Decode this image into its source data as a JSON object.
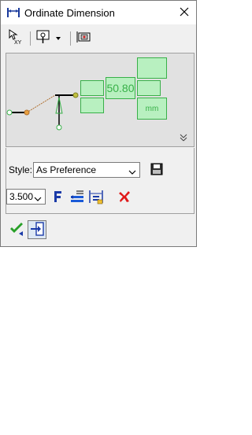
{
  "window": {
    "title": "Ordinate Dimension",
    "icon": "ordinate-dimension-icon",
    "close_icon": "close-icon"
  },
  "toolbar": {
    "items": [
      "select-xy-icon",
      "origin-point-icon",
      "dropdown-arrow-icon",
      "dimension-settings-icon"
    ],
    "origin_label": "XY"
  },
  "preview": {
    "value_text": "50.80",
    "unit_text": "mm",
    "expand_icon": "double-chevron-down-icon",
    "colors": {
      "accent": "#38b048",
      "fill": "#b8f0c0",
      "handle": "#e8a040"
    }
  },
  "style": {
    "label": "Style:",
    "selected": "As Preference",
    "save_icon": "save-style-icon"
  },
  "text_height": {
    "selected": "3.500"
  },
  "format_buttons": [
    "font-icon",
    "text-alignment-icon",
    "dimension-format-icon",
    "delete-icon"
  ],
  "bottom": {
    "ok_icon": "check-icon",
    "exit_icon": "exit-icon"
  }
}
